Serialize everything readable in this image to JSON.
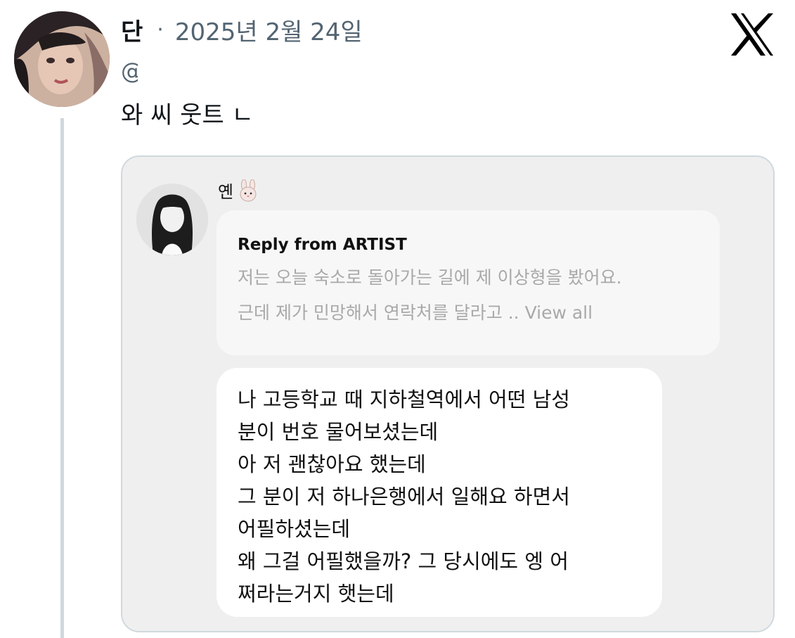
{
  "post": {
    "author_name": "단",
    "separator": "·",
    "date": "2025년 2월 24일",
    "handle": "@",
    "text": "와 씨 웃트 ㄴ",
    "logo_icon": "x-logo-icon"
  },
  "embedded": {
    "sender_name": "옌",
    "sender_icon": "bunny-icon",
    "reply": {
      "title": "Reply from ARTIST",
      "line1": "저는 오늘 숙소로 돌아가는 길에 제 이상형을 봤어요.",
      "line2": "근데 제가 민망해서 연락처를 달라고 .. View all"
    },
    "message_lines": [
      "나 고등학교 때 지하철역에서 어떤 남성",
      "분이 번호 물어보셨는데",
      "아 저 괜찮아요 했는데",
      "그 분이 저 하나은행에서 일해요 하면서",
      "어필하셨는데",
      "왜 그걸 어필했을까? 그 당시에도 엥 어",
      "쩌라는거지 햇는데"
    ]
  },
  "colors": {
    "text_primary": "#0f1419",
    "text_secondary": "#536471",
    "border": "#cfd9de",
    "card_bg": "#efefef"
  }
}
